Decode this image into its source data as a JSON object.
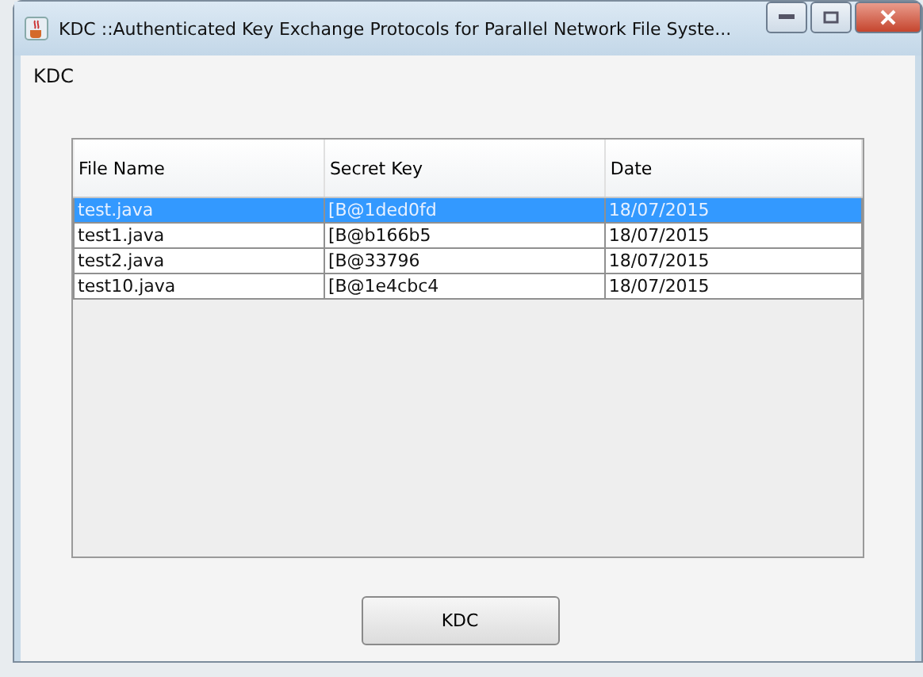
{
  "window": {
    "title": "KDC ::Authenticated Key Exchange Protocols for Parallel Network File Syste..."
  },
  "panel_title": "KDC",
  "table": {
    "columns": [
      "File Name",
      "Secret Key",
      "Date"
    ],
    "rows": [
      {
        "cells": [
          "test.java",
          "[B@1ded0fd",
          "18/07/2015"
        ],
        "selected": true
      },
      {
        "cells": [
          "test1.java",
          "[B@b166b5",
          "18/07/2015"
        ],
        "selected": false
      },
      {
        "cells": [
          "test2.java",
          "[B@33796",
          "18/07/2015"
        ],
        "selected": false
      },
      {
        "cells": [
          "test10.java",
          "[B@1e4cbc4",
          "18/07/2015"
        ],
        "selected": false
      }
    ]
  },
  "button": "KDC"
}
